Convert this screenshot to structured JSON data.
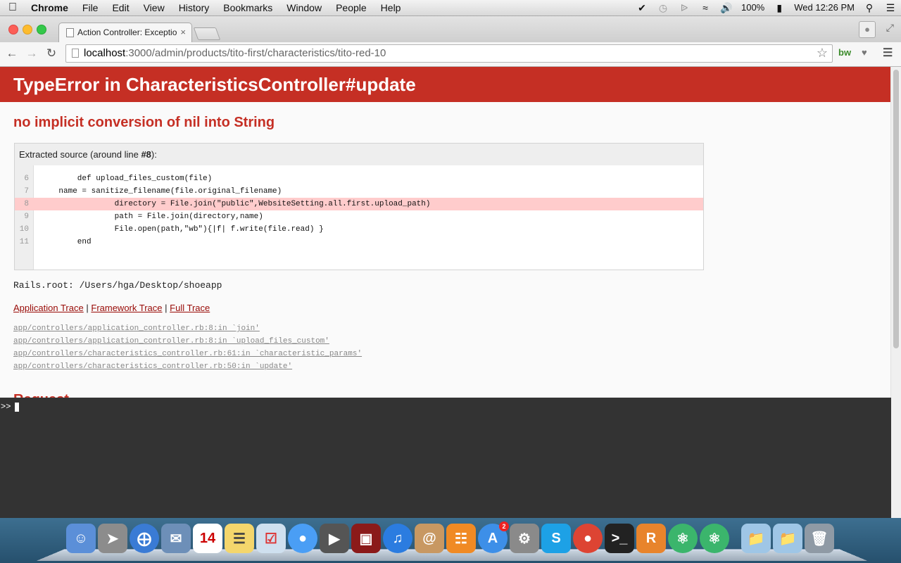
{
  "menubar": {
    "apple": "",
    "app_name": "Chrome",
    "items": [
      "File",
      "Edit",
      "View",
      "History",
      "Bookmarks",
      "Window",
      "People",
      "Help"
    ],
    "battery": "100%",
    "clock": "Wed 12:26 PM"
  },
  "tab": {
    "title": "Action Controller: Exceptio",
    "close": "×"
  },
  "toolbar": {
    "url_host": "localhost",
    "url_path": ":3000/admin/products/tito-first/characteristics/tito-red-10",
    "ext_bw": "bw"
  },
  "error": {
    "title": "TypeError in CharacteristicsController#update",
    "message": "no implicit conversion of nil into String"
  },
  "source": {
    "header_prefix": "Extracted source (around line ",
    "header_line": "#8",
    "header_suffix": "):",
    "lines": [
      {
        "num": "6",
        "text": "        def upload_files_custom(file)"
      },
      {
        "num": "7",
        "text": "    name = sanitize_filename(file.original_filename)"
      },
      {
        "num": "8",
        "text": "                directory = File.join(\"public\",WebsiteSetting.all.first.upload_path)"
      },
      {
        "num": "9",
        "text": "                path = File.join(directory,name)"
      },
      {
        "num": "10",
        "text": "                File.open(path,\"wb\"){|f| f.write(file.read) }"
      },
      {
        "num": "11",
        "text": "        end"
      }
    ]
  },
  "rails_root": "Rails.root: /Users/hga/Desktop/shoeapp",
  "trace_links": {
    "application": "Application Trace",
    "framework": "Framework Trace",
    "full": "Full Trace",
    "sep": "|"
  },
  "trace_items": [
    "app/controllers/application_controller.rb:8:in `join'",
    "app/controllers/application_controller.rb:8:in `upload_files_custom'",
    "app/controllers/characteristics_controller.rb:61:in `characteristic_params'",
    "app/controllers/characteristics_controller.rb:50:in `update'"
  ],
  "next_heading": "Request",
  "console": {
    "prompt": ">>"
  },
  "dock": {
    "app_store_badge": "2",
    "calendar_day": "14"
  }
}
